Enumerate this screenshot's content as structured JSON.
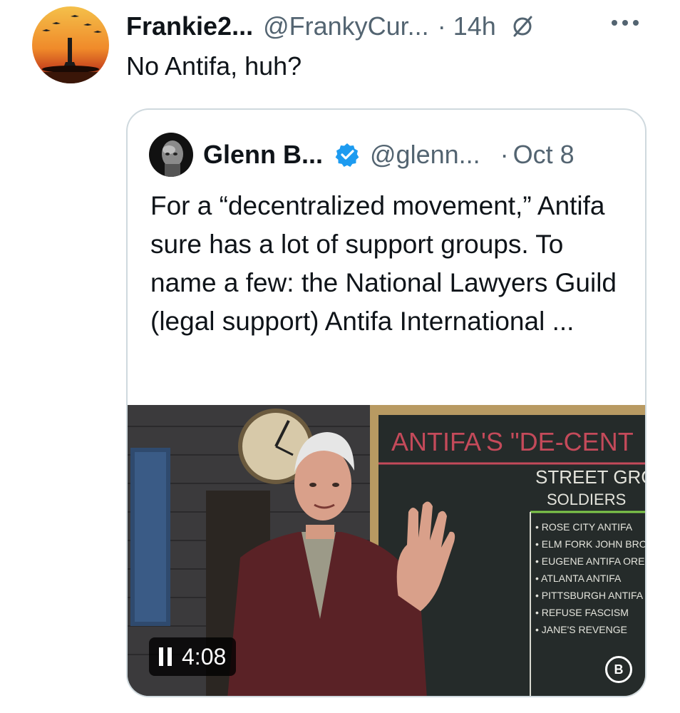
{
  "tweet": {
    "display_name": "Frankie2...",
    "handle": "@FrankyCur...",
    "separator": "·",
    "time": "14h",
    "text": "No Antifa, huh?"
  },
  "quoted": {
    "display_name": "Glenn B...",
    "handle": "@glenn...",
    "separator": "·",
    "time": "Oct 8",
    "text": "For a “decentralized movement,” Antifa sure has a lot of support groups. To name a few: the National Lawyers Guild (legal support) Antifa International ...",
    "video": {
      "duration": "4:08",
      "board_title": "ANTIFA'S \"DE-CENT",
      "board_heading_1": "STREET GROUP",
      "board_heading_2": "SOLDIERS",
      "board_items": [
        "ROSE CITY ANTIFA",
        "ELM FORK JOHN BROWN",
        "EUGENE ANTIFA OREGON",
        "ATLANTA ANTIFA",
        "PITTSBURGH ANTIFA",
        "REFUSE FASCISM",
        "JANE'S REVENGE"
      ],
      "logo": "B"
    }
  },
  "colors": {
    "text_primary": "#0f1419",
    "text_secondary": "#536471",
    "verified": "#1d9bf0",
    "card_border": "#cfd9de"
  },
  "icons": {
    "muted": "muted-icon",
    "more": "more-icon",
    "verified": "verified-badge-icon",
    "pause": "pause-icon"
  }
}
